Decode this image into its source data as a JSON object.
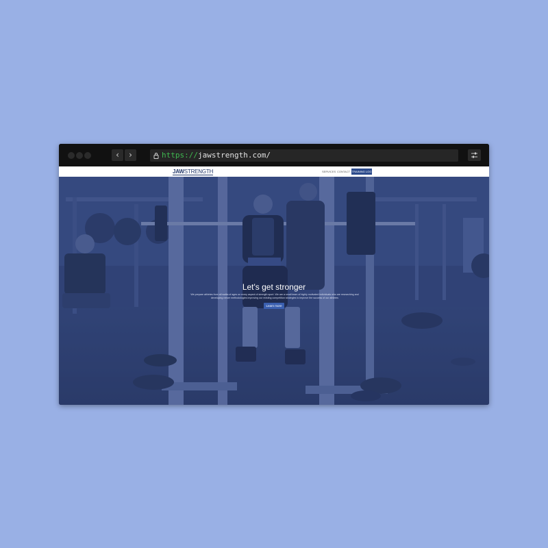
{
  "browser": {
    "url_scheme": "https://",
    "url_host": "jawstrength.com/",
    "back_glyph": "‹",
    "forward_glyph": "›"
  },
  "site": {
    "logo_bold": "JAW",
    "logo_light": "STRENGTH",
    "nav": {
      "services": "SERVICES",
      "contact": "CONTACT",
      "cta": "TRAINING LOG"
    },
    "hero": {
      "title": "Let's get stronger",
      "text": "We prepare athletes from all walks of ages on every aspect of strength sport. We are a small team of highly motivated individuals who are researching and developing newer methodologies improving our existing competition strategies to improve the success of our athletes",
      "button": "Learn more"
    }
  },
  "colors": {
    "page_background": "#99b0e5",
    "brand_blue": "#2d4b8c",
    "hero_overlay": "#2c3e6e",
    "url_scheme_green": "#3fb950"
  },
  "icons": [
    "lock-icon",
    "settings-sliders-icon",
    "chevron-left-icon",
    "chevron-right-icon"
  ]
}
